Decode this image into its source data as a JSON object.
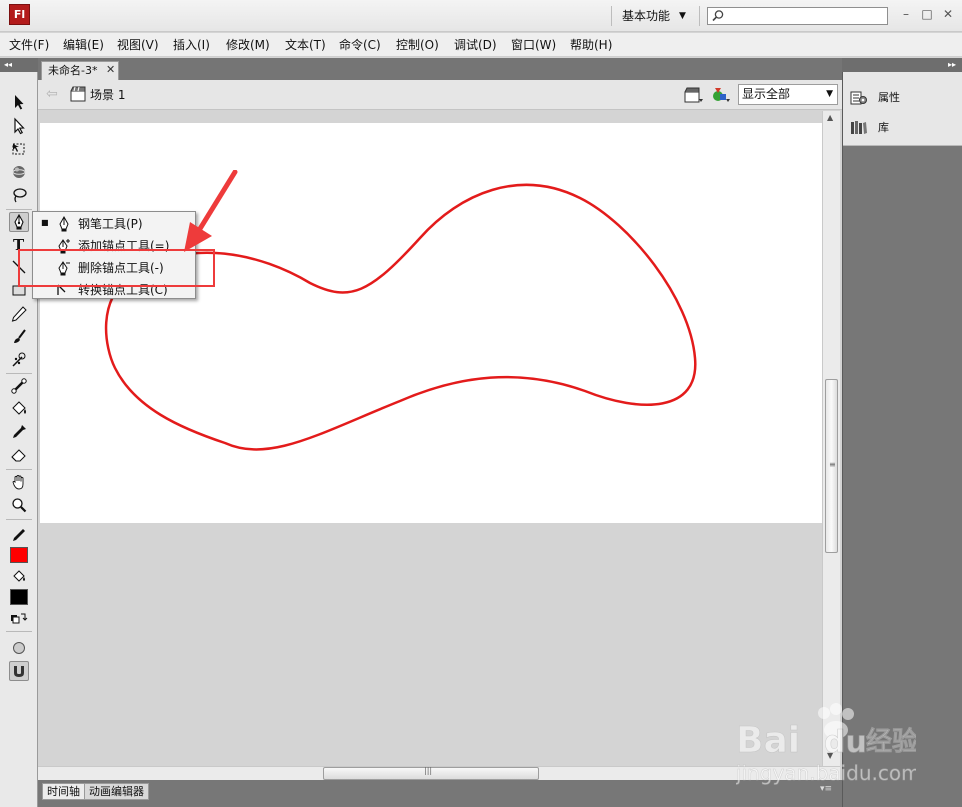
{
  "app": {
    "logo_text": "Fl"
  },
  "titlebar": {
    "workspace": "基本功能",
    "workspace_arrow": "▼",
    "search_placeholder": "",
    "minimize": "–",
    "maximize": "□",
    "close": "✕"
  },
  "menus": [
    "文件(F)",
    "编辑(E)",
    "视图(V)",
    "插入(I)",
    "修改(M)",
    "文本(T)",
    "命令(C)",
    "控制(O)",
    "调试(D)",
    "窗口(W)",
    "帮助(H)"
  ],
  "document": {
    "tab_label": "未命名-3*",
    "tab_close": "✕",
    "scene_label": "场景 1",
    "zoom_value": "显示全部",
    "back_arrow": "⇦"
  },
  "tools": [
    "selection-tool",
    "subselection-tool",
    "free-transform-tool",
    "3d-rotation-tool",
    "lasso-tool",
    "pen-tool",
    "text-tool",
    "line-tool",
    "rectangle-tool",
    "pencil-tool",
    "brush-tool",
    "deco-tool",
    "bone-tool",
    "paint-bucket-tool",
    "eyedropper-tool",
    "eraser-tool",
    "hand-tool",
    "zoom-tool"
  ],
  "colors": {
    "stroke": "#ff0000",
    "fill": "#000000",
    "curve": "#e31b1b",
    "annotation": "#ee3b3b"
  },
  "pen_menu": {
    "items": [
      {
        "bullet": "■",
        "label": "钢笔工具(P)"
      },
      {
        "bullet": "",
        "label": "添加锚点工具(=)"
      },
      {
        "bullet": "",
        "label": "删除锚点工具(-)"
      },
      {
        "bullet": "",
        "label": "转换锚点工具(C)"
      }
    ]
  },
  "right_panel": {
    "items": [
      {
        "label": "属性",
        "icon": "properties-icon"
      },
      {
        "label": "库",
        "icon": "library-icon"
      }
    ]
  },
  "bottom_tabs": [
    "时间轴",
    "动画编辑器"
  ],
  "watermark": {
    "brand": "Bai du 经验",
    "url": "jingyan.baidu.com"
  }
}
